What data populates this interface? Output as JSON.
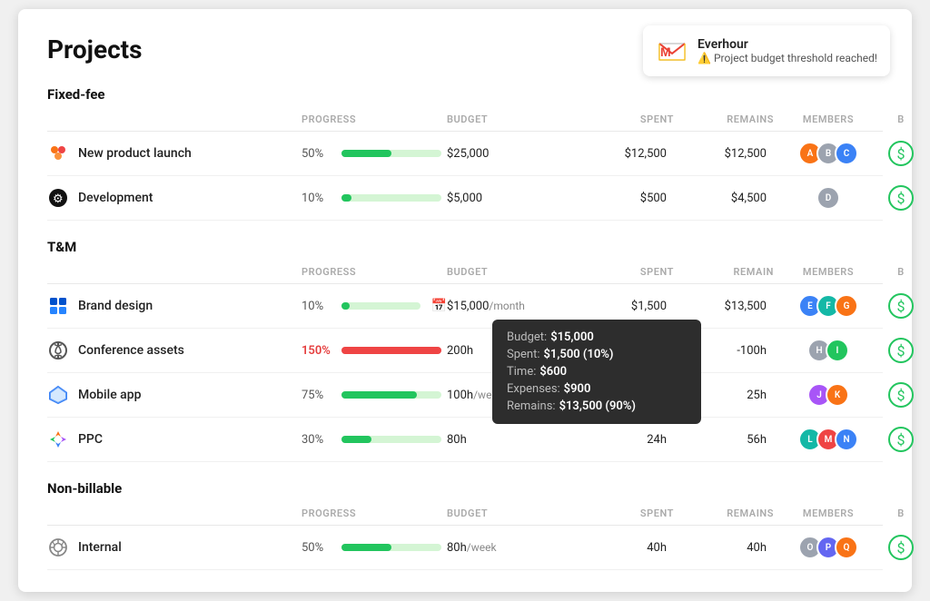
{
  "page": {
    "title": "Projects"
  },
  "notification": {
    "icon": "M",
    "app_name": "Everhour",
    "message": "⚠️ Project budget threshold reached!"
  },
  "sections": [
    {
      "id": "fixed-fee",
      "label": "Fixed-fee",
      "col_headers": [
        "",
        "PROGRESS",
        "BUDGET",
        "SPENT",
        "REMAINS",
        "MEMBERS",
        "B"
      ],
      "projects": [
        {
          "id": "new-product-launch",
          "icon": "cluster",
          "name": "New product launch",
          "progress_pct": "50%",
          "progress_val": 50,
          "budget": "$25,000",
          "spent": "$12,500",
          "remains": "$12,500",
          "members": 3,
          "over": false,
          "has_calendar": false
        },
        {
          "id": "development",
          "icon": "github",
          "name": "Development",
          "progress_pct": "10%",
          "progress_val": 10,
          "budget": "$5,000",
          "spent": "$500",
          "remains": "$4,500",
          "members": 1,
          "over": false,
          "has_calendar": false
        }
      ]
    },
    {
      "id": "tm",
      "label": "T&M",
      "col_headers": [
        "",
        "PROGRESS",
        "BUDGET",
        "SPENT",
        "REMAIN",
        "MEMBERS",
        "B"
      ],
      "projects": [
        {
          "id": "brand-design",
          "icon": "trello",
          "name": "Brand design",
          "progress_pct": "10%",
          "progress_val": 10,
          "budget": "$15,000",
          "budget_sub": "/month",
          "spent": "$1,500",
          "remains": "$13,500",
          "members": 3,
          "over": false,
          "has_calendar": true
        },
        {
          "id": "conference-assets",
          "icon": "sync",
          "name": "Conference assets",
          "progress_pct": "150%",
          "progress_val": 100,
          "budget": "200h",
          "spent": "",
          "remains": "-100h",
          "members": 2,
          "over": true,
          "has_calendar": false,
          "tooltip": {
            "budget_label": "Budget:",
            "budget_val": "$15,000",
            "spent_label": "Spent:",
            "spent_val": "$1,500 (10%)",
            "time_label": "Time:",
            "time_val": "$600",
            "expenses_label": "Expenses:",
            "expenses_val": "$900",
            "remains_label": "Remains:",
            "remains_val": "$13,500 (90%)"
          }
        },
        {
          "id": "mobile-app",
          "icon": "diamond",
          "name": "Mobile app",
          "progress_pct": "75%",
          "progress_val": 75,
          "budget": "100h",
          "budget_sub": "/week",
          "spent": "",
          "remains": "25h",
          "members": 2,
          "over": false,
          "has_calendar": false
        },
        {
          "id": "ppc",
          "icon": "ppc",
          "name": "PPC",
          "progress_pct": "30%",
          "progress_val": 30,
          "budget": "80h",
          "spent": "24h",
          "remains": "56h",
          "members": 3,
          "over": false,
          "has_calendar": false
        }
      ]
    },
    {
      "id": "non-billable",
      "label": "Non-billable",
      "col_headers": [
        "",
        "PROGRESS",
        "BUDGET",
        "SPENT",
        "REMAINS",
        "MEMBERS",
        "B"
      ],
      "projects": [
        {
          "id": "internal",
          "icon": "globe",
          "name": "Internal",
          "progress_pct": "50%",
          "progress_val": 50,
          "budget": "80h",
          "budget_sub": "/week",
          "spent": "40h",
          "remains": "40h",
          "members": 3,
          "over": false,
          "has_calendar": false
        }
      ]
    }
  ]
}
